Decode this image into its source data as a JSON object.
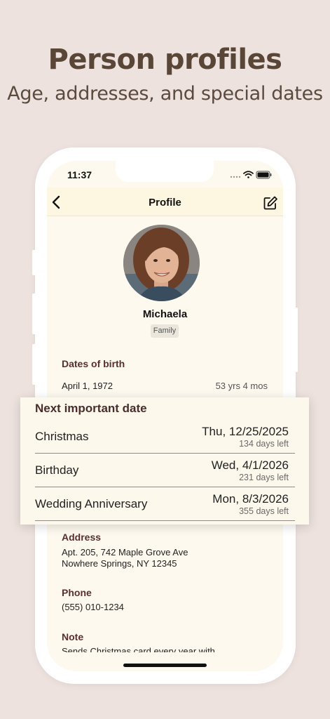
{
  "hero": {
    "title": "Person profiles",
    "subtitle": "Age, addresses, and special dates"
  },
  "status_bar": {
    "time": "11:37",
    "icons": [
      "signal-icon",
      "wifi-icon",
      "battery-icon"
    ]
  },
  "navbar": {
    "title": "Profile",
    "back_icon": "chevron-left-icon",
    "edit_icon": "edit-icon"
  },
  "profile": {
    "name": "Michaela",
    "tag": "Family"
  },
  "dates_of_birth": {
    "label": "Dates of birth",
    "date": "April 1, 1972",
    "age": "53 yrs 4 mos"
  },
  "next_dates": {
    "title": "Next important date",
    "events": [
      {
        "name": "Christmas",
        "date": "Thu, 12/25/2025",
        "days_left": "134 days left"
      },
      {
        "name": "Birthday",
        "date": "Wed, 4/1/2026",
        "days_left": "231 days left"
      },
      {
        "name": "Wedding Anniversary",
        "date": "Mon, 8/3/2026",
        "days_left": "355 days left"
      }
    ]
  },
  "address": {
    "label": "Address",
    "line1": "Apt. 205, 742 Maple Grove Ave",
    "line2": "Nowhere Springs, NY 12345"
  },
  "phone": {
    "label": "Phone",
    "value": "(555) 010-1234"
  },
  "note": {
    "label": "Note",
    "value": "Sends Christmas card every year with"
  },
  "colors": {
    "background": "#ede2dd",
    "screen": "#fdf9ee",
    "accent_label": "#5a2f2f",
    "hero_text": "#5a4636"
  }
}
